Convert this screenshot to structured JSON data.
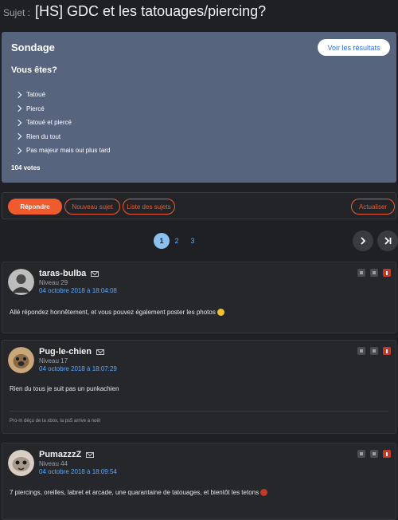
{
  "page": {
    "title_prefix": "Sujet :",
    "title": "[HS] GDC et les tatouages/piercing?"
  },
  "poll": {
    "title": "Sondage",
    "results_label": "Voir les résultats",
    "question": "Vous êtes?",
    "options": [
      "Tatoué",
      "Piercé",
      "Tatoué et piercé",
      "Rien du tout",
      "Pas majeur mais oui plus tard"
    ],
    "votes": "104 votes"
  },
  "actions": {
    "reply": "Répondre",
    "new_topic": "Nouveau sujet",
    "topic_list": "Liste des sujets",
    "refresh": "Actualiser"
  },
  "pager": {
    "pages": [
      "1",
      "2",
      "3"
    ]
  },
  "posts": [
    {
      "author": "taras-bulba",
      "level": "Niveau 29",
      "date": "04 octobre 2018 à 18:04:08",
      "body": "Allé répondez honnêtement, et vous pouvez également poster les photos",
      "signature": ""
    },
    {
      "author": "Pug-le-chien",
      "level": "Niveau 17",
      "date": "04 octobre 2018 à 18:07:29",
      "body": "Rien du tous je suit pas un punkachien",
      "signature": "Pro-m déçu de la xbox, la ps5 arrive à noël"
    },
    {
      "author": "PumazzzZ",
      "level": "Niveau 44",
      "date": "04 octobre 2018 à 18:09:54",
      "body": "7 piercings, oreilles, labret et arcade, une quarantaine de tatouages, et bientôt les tetons",
      "signature": ""
    }
  ],
  "colors": {
    "accent": "#ef5a2f",
    "link": "#5aa9ff",
    "poll_bg": "#56647e"
  }
}
